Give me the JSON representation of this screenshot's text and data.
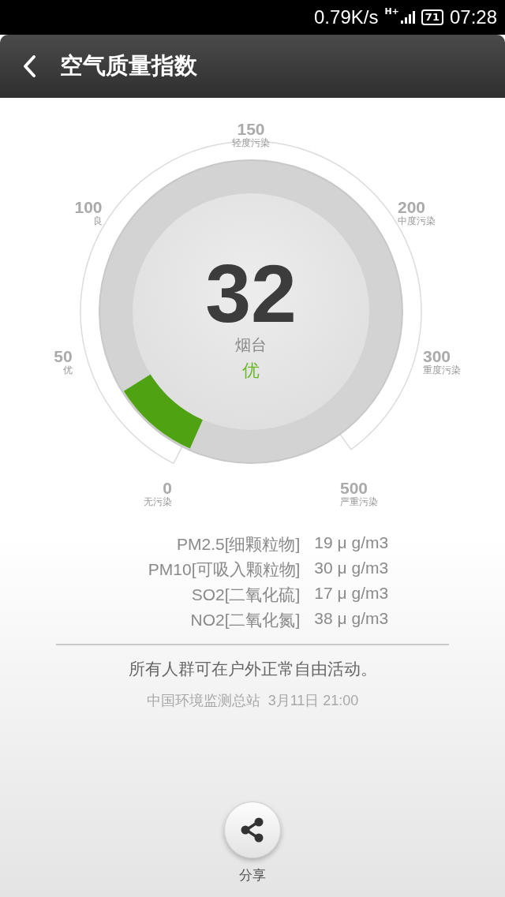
{
  "status_bar": {
    "speed": "0.79K/s",
    "network": "H+",
    "battery": "71",
    "time": "07:28"
  },
  "header": {
    "title": "空气质量指数"
  },
  "gauge": {
    "aqi": "32",
    "city": "烟台",
    "grade": "优",
    "ticks": [
      {
        "value": "0",
        "label": "无污染"
      },
      {
        "value": "50",
        "label": "优"
      },
      {
        "value": "100",
        "label": "良"
      },
      {
        "value": "150",
        "label": "轻度污染"
      },
      {
        "value": "200",
        "label": "中度污染"
      },
      {
        "value": "300",
        "label": "重度污染"
      },
      {
        "value": "500",
        "label": "严重污染"
      }
    ]
  },
  "pollutants": [
    {
      "name": "PM2.5[细颗粒物]",
      "value": "19 μ g/m3"
    },
    {
      "name": "PM10[可吸入颗粒物]",
      "value": "30 μ g/m3"
    },
    {
      "name": "SO2[二氧化硫]",
      "value": "17 μ g/m3"
    },
    {
      "name": "NO2[二氧化氮]",
      "value": "38 μ g/m3"
    }
  ],
  "advice": "所有人群可在户外正常自由活动。",
  "source": "中国环境监测总站",
  "updated": "3月11日 21:00",
  "share": {
    "label": "分享"
  }
}
